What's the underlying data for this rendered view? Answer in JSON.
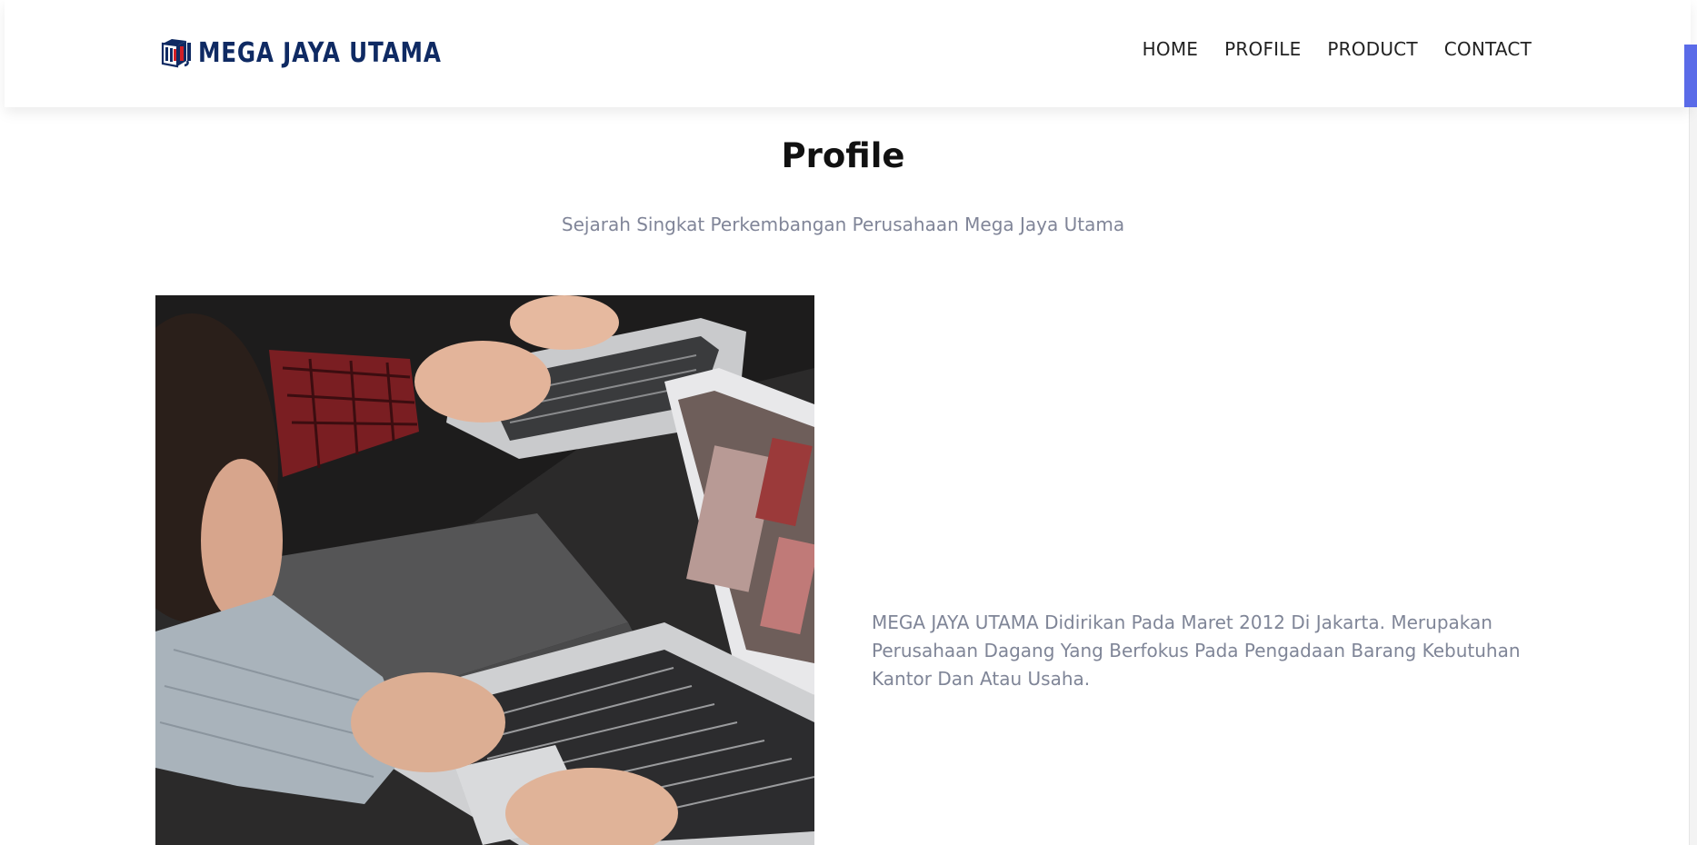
{
  "header": {
    "brand_name": "MEGA JAYA UTAMA",
    "logo_icon": "mju-logo-icon",
    "nav": [
      {
        "label": "HOME"
      },
      {
        "label": "PROFILE"
      },
      {
        "label": "PRODUCT"
      },
      {
        "label": "CONTACT"
      }
    ]
  },
  "section": {
    "title": "Profile",
    "subtitle": "Sejarah Singkat Perkembangan Perusahaan Mega Jaya Utama",
    "body": "MEGA JAYA UTAMA Didirikan Pada Maret 2012 Di Jakarta. Merupakan Perusahaan Dagang Yang Berfokus Pada Pengadaan Barang Kebutuhan Kantor Dan Atau Usaha.",
    "image": "people-using-laptops-photo"
  },
  "colors": {
    "brand": "#0f2a63",
    "logo_accent": "#d11f26",
    "scroll_accent": "#5a6be8",
    "muted_text": "#7f8597"
  }
}
